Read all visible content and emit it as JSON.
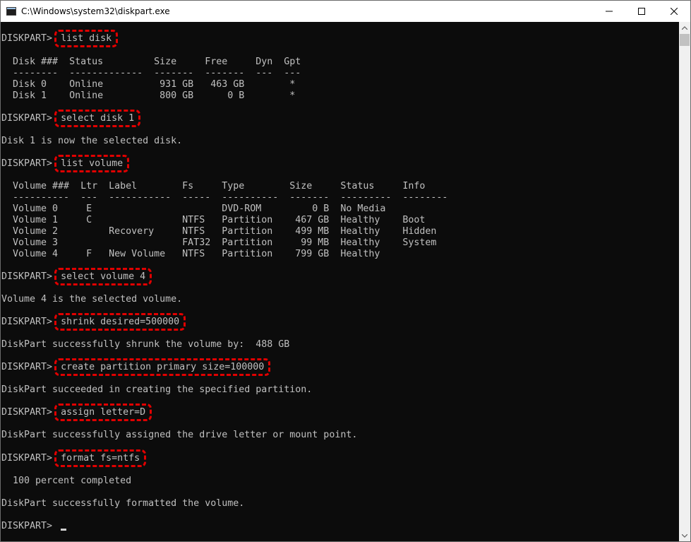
{
  "window": {
    "title": "C:\\Windows\\system32\\diskpart.exe",
    "icon": "console-icon",
    "buttons": [
      "minimize-icon",
      "maximize-icon",
      "close-icon"
    ]
  },
  "console": {
    "prompt": "DISKPART> ",
    "commands": [
      "list disk",
      "select disk 1",
      "list volume",
      "select volume 4",
      "shrink desired=500000",
      "create partition primary size=100000",
      "assign letter=D",
      "format fs=ntfs"
    ],
    "disk_table": {
      "header": "  Disk ###  Status         Size     Free     Dyn  Gpt",
      "separator": "  --------  -------------  -------  -------  ---  ---",
      "rows": [
        "  Disk 0    Online          931 GB   463 GB        *",
        "  Disk 1    Online          800 GB      0 B        *"
      ]
    },
    "select_disk_result": "Disk 1 is now the selected disk.",
    "volume_table": {
      "header": "  Volume ###  Ltr  Label        Fs     Type        Size     Status     Info",
      "separator": "  ----------  ---  -----------  -----  ----------  -------  ---------  --------",
      "rows": [
        "  Volume 0     E                       DVD-ROM         0 B  No Media",
        "  Volume 1     C                NTFS   Partition    467 GB  Healthy    Boot",
        "  Volume 2         Recovery     NTFS   Partition    499 MB  Healthy    Hidden",
        "  Volume 3                      FAT32  Partition     99 MB  Healthy    System",
        "  Volume 4     F   New Volume   NTFS   Partition    799 GB  Healthy"
      ]
    },
    "select_volume_result": "Volume 4 is the selected volume.",
    "shrink_result": "DiskPart successfully shrunk the volume by:  488 GB",
    "create_result": "DiskPart succeeded in creating the specified partition.",
    "assign_result": "DiskPart successfully assigned the drive letter or mount point.",
    "format_progress": "  100 percent completed",
    "format_result": "DiskPart successfully formatted the volume.",
    "final_prompt": "DISKPART> "
  },
  "colors": {
    "console_bg": "#0c0c0c",
    "console_text": "#c0c0c0",
    "highlight": "#e00000"
  }
}
